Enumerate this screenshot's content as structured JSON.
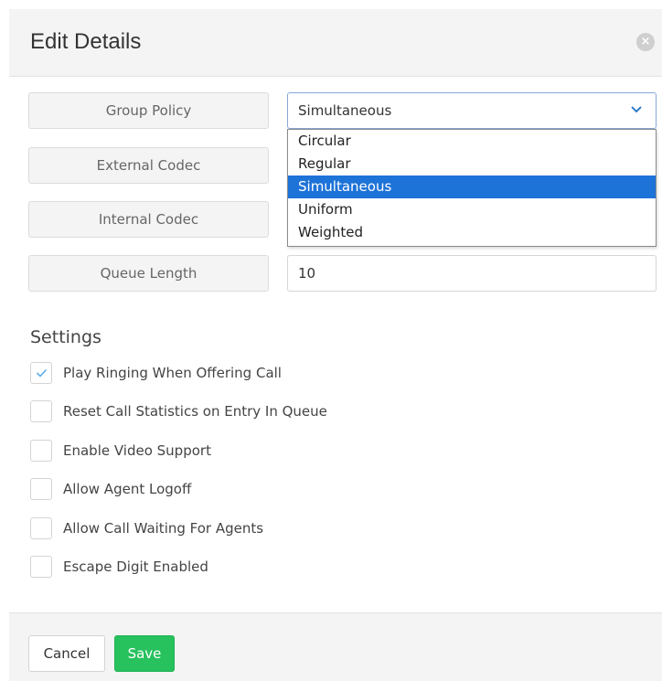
{
  "dialog": {
    "title": "Edit Details",
    "close_glyph": "×"
  },
  "form": {
    "group_policy": {
      "label": "Group Policy",
      "selected": "Simultaneous",
      "options": [
        "Circular",
        "Regular",
        "Simultaneous",
        "Uniform",
        "Weighted"
      ],
      "highlighted_index": 2
    },
    "external_codec": {
      "label": "External Codec"
    },
    "internal_codec": {
      "label": "Internal Codec"
    },
    "queue_length": {
      "label": "Queue Length",
      "value": "10"
    }
  },
  "settings": {
    "title": "Settings",
    "items": [
      {
        "label": "Play Ringing When Offering Call",
        "checked": true
      },
      {
        "label": "Reset Call Statistics on Entry In Queue",
        "checked": false
      },
      {
        "label": "Enable Video Support",
        "checked": false
      },
      {
        "label": "Allow Agent Logoff",
        "checked": false
      },
      {
        "label": "Allow Call Waiting For Agents",
        "checked": false
      },
      {
        "label": "Escape Digit Enabled",
        "checked": false
      }
    ]
  },
  "footer": {
    "cancel_label": "Cancel",
    "save_label": "Save"
  },
  "colors": {
    "accent": "#1e73d8",
    "save": "#27c15e",
    "check": "#5aaee6"
  }
}
